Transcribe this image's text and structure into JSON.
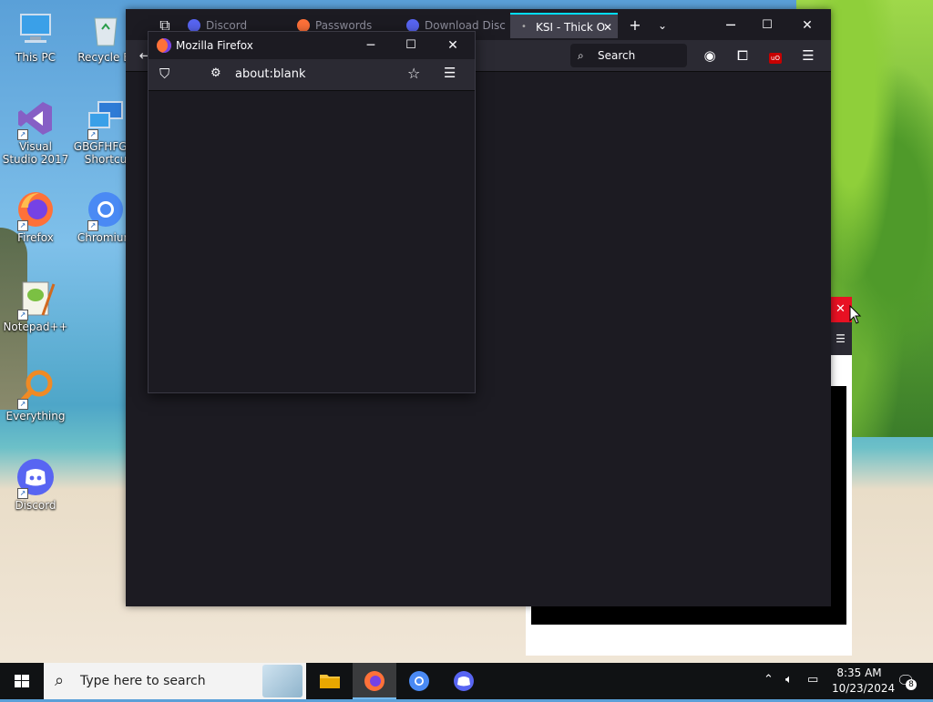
{
  "desktop": {
    "icons": [
      {
        "label": "This PC",
        "icon": "monitor-icon"
      },
      {
        "label": "Recycle Bi",
        "icon": "recycle-bin-icon"
      },
      {
        "label": "Visual Studio 2017",
        "icon": "visual-studio-icon"
      },
      {
        "label": "GBGFHFGI - Shortcu",
        "icon": "network-computer-icon"
      },
      {
        "label": "Firefox",
        "icon": "firefox-icon"
      },
      {
        "label": "Chromium",
        "icon": "chromium-icon"
      },
      {
        "label": "Notepad++",
        "icon": "notepadpp-icon"
      },
      {
        "label": "Everything",
        "icon": "everything-search-icon"
      },
      {
        "label": "Discord",
        "icon": "discord-icon"
      }
    ]
  },
  "browser": {
    "tabs": [
      {
        "label": "Discord",
        "icon": "discord-icon"
      },
      {
        "label": "Passwords",
        "icon": "firefox-icon"
      },
      {
        "label": "Download Disc",
        "icon": "discord-icon"
      },
      {
        "label": "KSI - Thick O",
        "icon": "dot-icon",
        "active": true
      }
    ],
    "search_label": "Search",
    "ublock_label": "uO"
  },
  "popup": {
    "title": "Mozilla Firefox",
    "url": "about:blank"
  },
  "taskbar": {
    "search_placeholder": "Type here to search",
    "time": "8:35 AM",
    "date": "10/23/2024",
    "notification_count": "8"
  },
  "colors": {
    "window_bg": "#1c1b22",
    "toolbar_bg": "#2b2a33",
    "active_tab_accent": "#00ddff",
    "discord_blurple": "#5865f2",
    "close_red": "#e81123"
  }
}
